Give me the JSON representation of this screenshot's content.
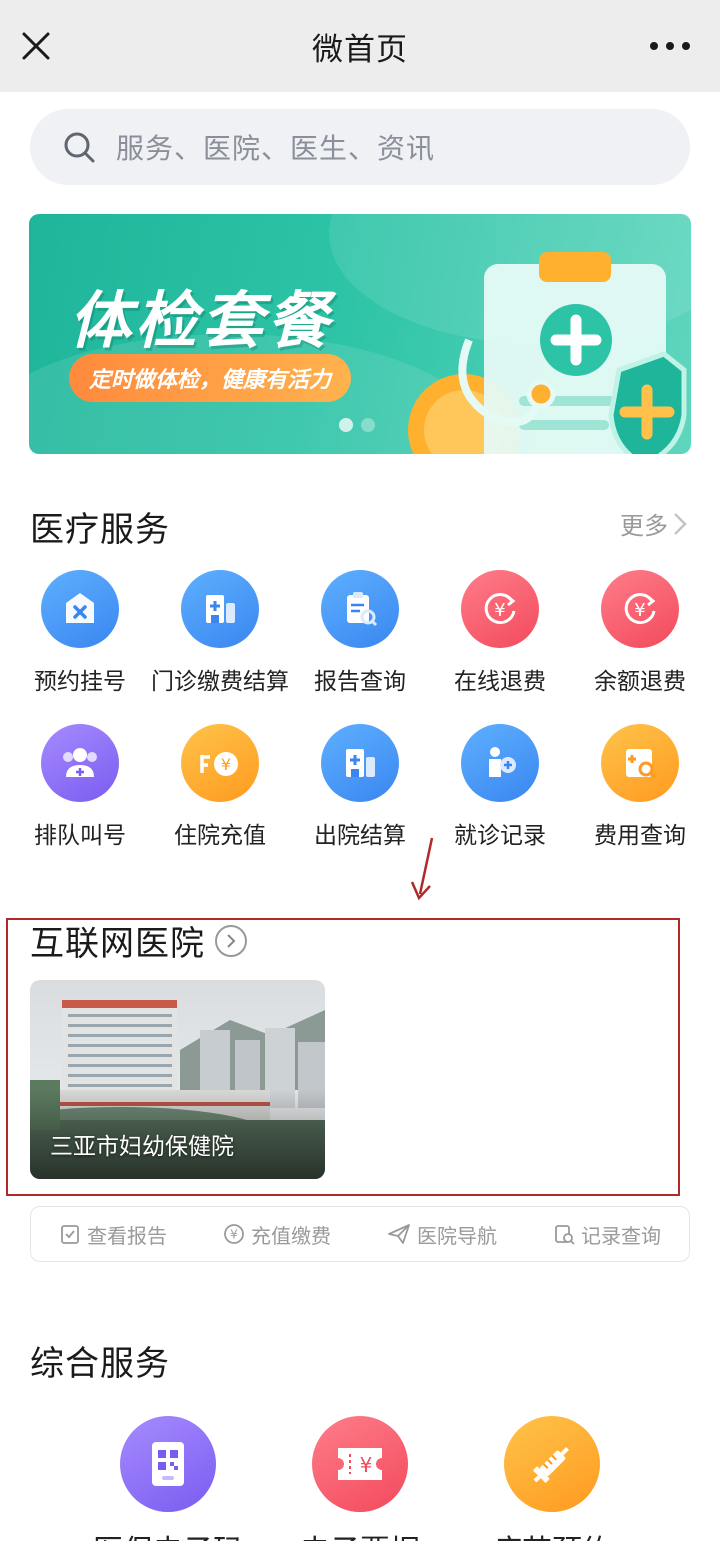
{
  "header": {
    "title": "微首页",
    "close_icon": "close-icon",
    "more_icon": "more-icon"
  },
  "search": {
    "placeholder": "服务、医院、医生、资讯"
  },
  "banner": {
    "title": "体检套餐",
    "subtitle": "定时做体检，健康有活力",
    "slides": 2,
    "active_slide": 1
  },
  "medical": {
    "title": "医疗服务",
    "more": "更多",
    "row1": [
      {
        "label": "预约挂号",
        "icon": "ticket-icon",
        "color": "#3a86f0"
      },
      {
        "label": "门诊缴费结算",
        "icon": "building-icon",
        "color": "#3a86f0"
      },
      {
        "label": "报告查询",
        "icon": "report-search-icon",
        "color": "#3a86f0"
      },
      {
        "label": "在线退费",
        "icon": "yuan-refund-icon",
        "color": "#f24a5c"
      },
      {
        "label": "余额退费",
        "icon": "yuan-refund-icon",
        "color": "#f24a5c"
      }
    ],
    "row2": [
      {
        "label": "排队叫号",
        "icon": "queue-users-icon",
        "color": "#7a5cf0"
      },
      {
        "label": "住院充值",
        "icon": "yuan-recharge-icon",
        "color": "#ff9a1f"
      },
      {
        "label": "出院结算",
        "icon": "building-icon",
        "color": "#3a86f0"
      },
      {
        "label": "就诊记录",
        "icon": "patient-record-icon",
        "color": "#3a86f0"
      },
      {
        "label": "费用查询",
        "icon": "fee-search-icon",
        "color": "#ff9a1f"
      }
    ]
  },
  "internet_hospital": {
    "title": "互联网医院",
    "hospital_name": "三亚市妇幼保健院",
    "actions": [
      {
        "label": "查看报告",
        "icon": "clipboard-check-icon"
      },
      {
        "label": "充值缴费",
        "icon": "yuan-coin-icon"
      },
      {
        "label": "医院导航",
        "icon": "paper-plane-icon"
      },
      {
        "label": "记录查询",
        "icon": "record-search-icon"
      }
    ]
  },
  "general": {
    "title": "综合服务",
    "items": [
      {
        "label": "医保电子码",
        "icon": "qr-card-icon",
        "color": "#7a5cf0"
      },
      {
        "label": "电子票据",
        "icon": "yuan-ticket-icon",
        "color": "#f24a5c"
      },
      {
        "label": "疫苗预约",
        "icon": "syringe-icon",
        "color": "#ff9a1f"
      }
    ]
  }
}
